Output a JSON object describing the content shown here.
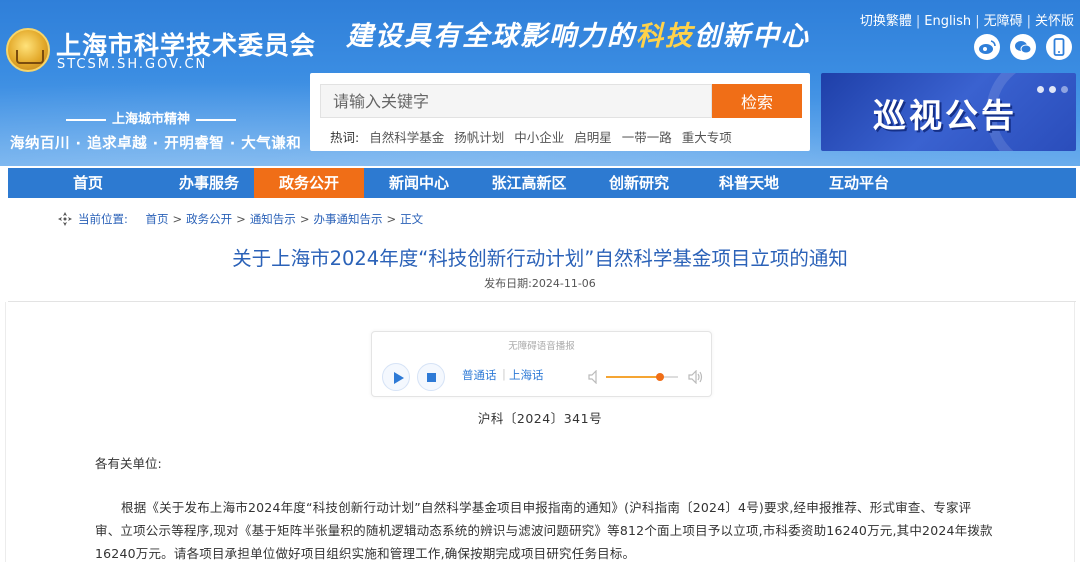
{
  "header": {
    "site_title": "上海市科学技术委员会",
    "site_domain": "STCSM.SH.GOV.CN",
    "slogan_prefix": "建设具有全球影响力的",
    "slogan_highlight": "科技",
    "slogan_suffix": "创新中心",
    "top_links": [
      "切换繁體",
      "English",
      "无障碍",
      "关怀版"
    ],
    "social_icons": [
      "weibo-icon",
      "wechat-icon",
      "mobile-icon"
    ],
    "spirit_title": "上海城市精神",
    "spirit_text": "海纳百川 · 追求卓越 · 开明睿智 · 大气谦和"
  },
  "search": {
    "placeholder": "请输入关键字",
    "button_label": "检索",
    "hot_label": "热词:",
    "hot_words": [
      "自然科学基金",
      "扬帆计划",
      "中小企业",
      "启明星",
      "一带一路",
      "重大专项"
    ]
  },
  "banner": {
    "text": "巡视公告",
    "active_slide": 1,
    "slide_count": 3
  },
  "nav": {
    "items": [
      "首页",
      "办事服务",
      "政务公开",
      "新闻中心",
      "张江高新区",
      "创新研究",
      "科普天地",
      "互动平台"
    ],
    "active_index": 2
  },
  "breadcrumb": {
    "label": "当前位置:",
    "items": [
      "首页",
      "政务公开",
      "通知告示",
      "办事通知告示",
      "正文"
    ]
  },
  "article": {
    "title": "关于上海市2024年度“科技创新行动计划”自然科学基金项目立项的通知",
    "pub_date": "发布日期:2024-11-06",
    "doc_number": "沪科〔2024〕341号",
    "greeting": "各有关单位:",
    "body": "根据《关于发布上海市2024年度“科技创新行动计划”自然科学基金项目申报指南的通知》(沪科指南〔2024〕4号)要求,经申报推荐、形式审查、专家评审、立项公示等程序,现对《基于矩阵半张量积的随机逻辑动态系统的辨识与滤波问题研究》等812个面上项目予以立项,市科委资助16240万元,其中2024年拨款16240万元。请各项目承担单位做好项目组织实施和管理工作,确保按期完成项目研究任务目标。"
  },
  "player": {
    "caption": "无障碍语音播报",
    "dialect_mandarin": "普通话",
    "dialect_shanghai": "上海话",
    "volume_level": 0.75,
    "accent_color": "#2e7ad6",
    "volume_color": "#f06e17"
  },
  "colors": {
    "primary": "#2d7ad1",
    "accent": "#f06e17",
    "title": "#2b62b8"
  }
}
